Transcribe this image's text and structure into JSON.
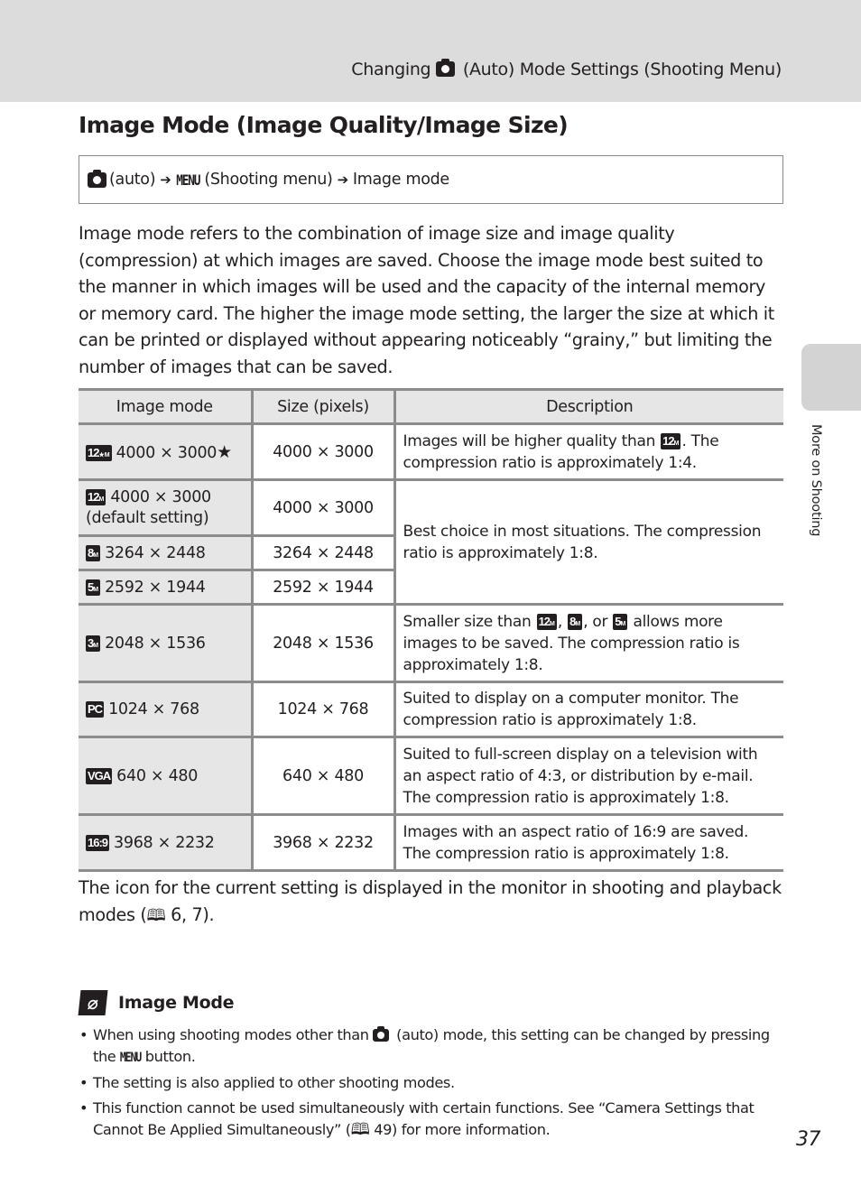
{
  "header": {
    "running_head_prefix": "Changing",
    "running_head_suffix": "(Auto) Mode Settings (Shooting Menu)",
    "camera_icon": "camera-icon"
  },
  "side_tab": {
    "label": "More on Shooting"
  },
  "page": {
    "title": "Image Mode (Image Quality/Image Size)",
    "number": "37"
  },
  "nav_path": {
    "step1": "(auto)",
    "menu_word": "MENU",
    "step2": "(Shooting menu)",
    "step3": "Image mode",
    "arrow": "➔"
  },
  "intro": "Image mode refers to the combination of image size and image quality (compression) at which images are saved. Choose the image mode best suited to the manner in which images will be used and the capacity of the internal memory or memory card. The higher the image mode setting, the larger the size at which it can be printed or displayed without appearing noticeably “grainy,” but limiting the number of images that can be saved.",
  "table": {
    "headers": [
      "Image mode",
      "Size (pixels)",
      "Description"
    ],
    "rows": [
      {
        "badge": "12",
        "badge_sub": "M★",
        "mode": "4000 × 3000",
        "mode_extra": "★",
        "size": "4000 × 3000",
        "desc_before": "Images will be higher quality than",
        "desc_badge": "12",
        "desc_after": ". The compression ratio is approximately 1:4."
      },
      {
        "badge": "12",
        "badge_sub": "M",
        "mode": "4000 × 3000",
        "mode_line2": "(default setting)",
        "size": "4000 × 3000"
      },
      {
        "badge": "8",
        "badge_sub": "M",
        "mode": "3264 × 2448",
        "size": "3264 × 2448"
      },
      {
        "badge": "5",
        "badge_sub": "M",
        "mode": "2592 × 1944",
        "size": "2592 × 1944"
      },
      {
        "badge": "3",
        "badge_sub": "M",
        "mode": "2048 × 1536",
        "size": "2048 × 1536",
        "desc_before": "Smaller size than",
        "desc_after": "allows more images to be saved. The compression ratio is approximately 1:8.",
        "desc_sep1": ",",
        "desc_sep2": ", or"
      },
      {
        "badge": "PC",
        "badge_sub": "",
        "mode": "1024 × 768",
        "size": "1024 × 768",
        "desc": "Suited to display on a computer monitor. The compression ratio is approximately 1:8."
      },
      {
        "badge": "VGA",
        "badge_sub": "",
        "mode": "640 × 480",
        "size": "640 × 480",
        "desc": "Suited to full-screen display on a television with an aspect ratio of 4:3, or distribution by e-mail. The compression ratio is approximately 1:8."
      },
      {
        "badge": "16:9",
        "badge_sub": "",
        "mode": "3968 × 2232",
        "size": "3968 × 2232",
        "desc": "Images with an aspect ratio of 16:9 are saved. The compression ratio is approximately 1:8."
      }
    ],
    "merged_desc": "Best choice in most situations. The compression ratio is approximately 1:8."
  },
  "after_text": {
    "before": "The icon for the current setting is displayed in the monitor in shooting and playback modes (",
    "ref": "6, 7",
    "after": ")."
  },
  "note": {
    "title": "Image Mode",
    "icon": "paperclip-icon",
    "bullets": [
      {
        "before": "When using shooting modes other than",
        "mid": "(auto) mode, this setting can be changed by pressing the",
        "menu_word": "MENU",
        "after": "button."
      },
      {
        "text": "The setting is also applied to other shooting modes."
      },
      {
        "before": "This function cannot be used simultaneously with certain functions. See “Camera Settings that Cannot Be Applied Simultaneously” (",
        "ref": "49",
        "after": ") for more information."
      }
    ]
  },
  "glyphs": {
    "book": "🕮"
  }
}
